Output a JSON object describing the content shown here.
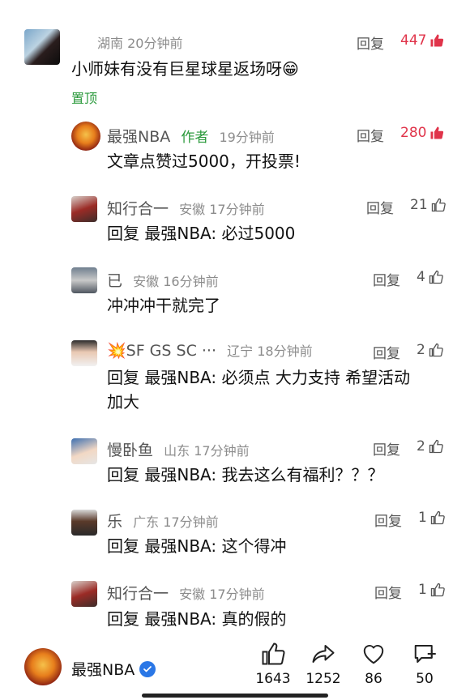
{
  "comments": [
    {
      "name": "",
      "author_tag": "",
      "location": "湖南",
      "time": "20分钟前",
      "reply_label": "回复",
      "likes": "447",
      "text": "小师妹有没有巨星球星返场呀😁",
      "pin_label": "置顶"
    },
    {
      "name": "最强NBA",
      "author_tag": "作者",
      "location": "",
      "time": "19分钟前",
      "reply_label": "回复",
      "likes": "280",
      "text": "文章点赞过5000，开投票!"
    },
    {
      "name": "知行合一",
      "location": "安徽",
      "time": "17分钟前",
      "reply_label": "回复",
      "likes": "21",
      "reply_prefix": "回复 ",
      "reply_target": "最强NBA",
      "text": ": 必过5000"
    },
    {
      "name": "已",
      "location": "安徽",
      "time": "16分钟前",
      "reply_label": "回复",
      "likes": "4",
      "text": "冲冲冲干就完了"
    },
    {
      "name": "💥SF GS SC ···",
      "location": "辽宁",
      "time": "18分钟前",
      "reply_label": "回复",
      "likes": "2",
      "reply_prefix": "回复 ",
      "reply_target": "最强NBA",
      "text": ": 必须点 大力支持 希望活动",
      "text_line2": "加大"
    },
    {
      "name": "慢卧鱼",
      "location": "山东",
      "time": "17分钟前",
      "reply_label": "回复",
      "likes": "2",
      "reply_prefix": "回复 ",
      "reply_target": "最强NBA",
      "text": ": 我去这么有福利？？？"
    },
    {
      "name": "乐",
      "location": "广东",
      "time": "17分钟前",
      "reply_label": "回复",
      "likes": "1",
      "reply_prefix": "回复 ",
      "reply_target": "最强NBA",
      "text": ": 这个得冲"
    },
    {
      "name": "知行合一",
      "location": "安徽",
      "time": "17分钟前",
      "reply_label": "回复",
      "likes": "1",
      "reply_prefix": "回复 ",
      "reply_target": "最强NBA",
      "text": ": 真的假的"
    }
  ],
  "bottom_bar": {
    "account_name": "最强NBA",
    "like_count": "1643",
    "share_count": "1252",
    "favorite_count": "86",
    "comment_count": "50"
  },
  "colors": {
    "hot_like": "#e0344a",
    "author_tag": "#2b9a3c",
    "verified": "#2a77e6"
  },
  "icons": [
    "thumb-up-icon",
    "thumb-up-filled-icon",
    "share-icon",
    "heart-icon",
    "comment-add-icon",
    "verified-icon"
  ]
}
